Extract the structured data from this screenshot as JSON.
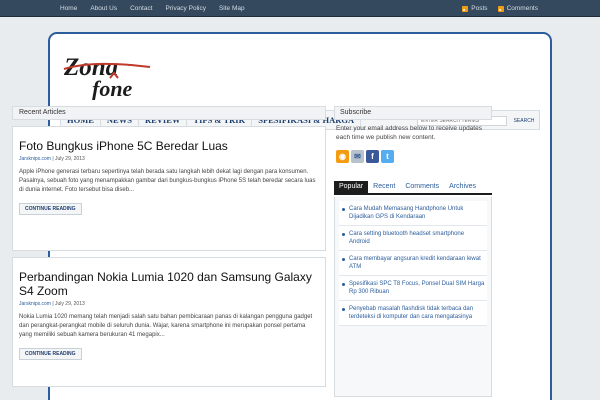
{
  "topnav": {
    "links": [
      "Home",
      "About Us",
      "Contact",
      "Privacy Policy",
      "Site Map"
    ],
    "feeds": [
      "Posts",
      "Comments"
    ]
  },
  "logo": {
    "line1": "Zona",
    "line2": "fone"
  },
  "catnav": {
    "items": [
      "HOME",
      "NEWS",
      "REVIEW",
      "TIPS & TRIK",
      "SPESIFIKASI & HARGA"
    ],
    "search_placeholder": "ENTER SEARCH TERMS",
    "search_button": "SEARCH"
  },
  "recent": {
    "heading": "Recent Articles",
    "articles": [
      {
        "title": "Foto Bungkus iPhone 5C Beredar Luas",
        "author": "Jarsknips.com",
        "date": "July 29, 2013",
        "excerpt": "Apple iPhone generasi terbaru sepertinya telah berada satu langkah lebih dekat lagi dengan para konsumen. Pasalnya, sebuah foto yang menampakkan gambar dari bungkus-bungkus iPhone 5S telah beredar secara luas di dunia internet. Foto tersebut bisa diseb...",
        "more": "CONTINUE READING"
      },
      {
        "title": "Perbandingan Nokia Lumia 1020 dan Samsung Galaxy S4 Zoom",
        "author": "Jarsknips.com",
        "date": "July 29, 2013",
        "excerpt": "Nokia Lumia 1020 memang telah menjadi salah satu bahan pembicaraan panas di kalangan pengguna gadget dan perangkat-perangkat mobile di seluruh dunia. Wajar, karena smartphone ini merupakan ponsel pertama yang memiliki sebuah kamera berukuran 41 megapix...",
        "more": "CONTINUE READING"
      }
    ]
  },
  "subscribe": {
    "heading": "Subscribe",
    "text": "Enter your email address below to receive updates each time we publish new content."
  },
  "tabs": [
    "Popular",
    "Recent",
    "Comments",
    "Archives"
  ],
  "popular": [
    "Cara Mudah Memasang Handphone Untuk Dijadikan GPS di Kendaraan",
    "Cara setting bluetooth headset smartphone Android",
    "Cara membayar angsuran kredit kendaraan lewat ATM",
    "Spesifikasi SPC T8 Focus, Ponsel Dual SIM Harga Rp 300 Ribuan",
    "Penyebab masalah flashdisk tidak terbaca dan terdeteksi di komputer dan cara mengatasinya"
  ],
  "colors": {
    "accent": "#2c5d9c",
    "topbar": "#34495e",
    "logo_red": "#c0392b"
  }
}
